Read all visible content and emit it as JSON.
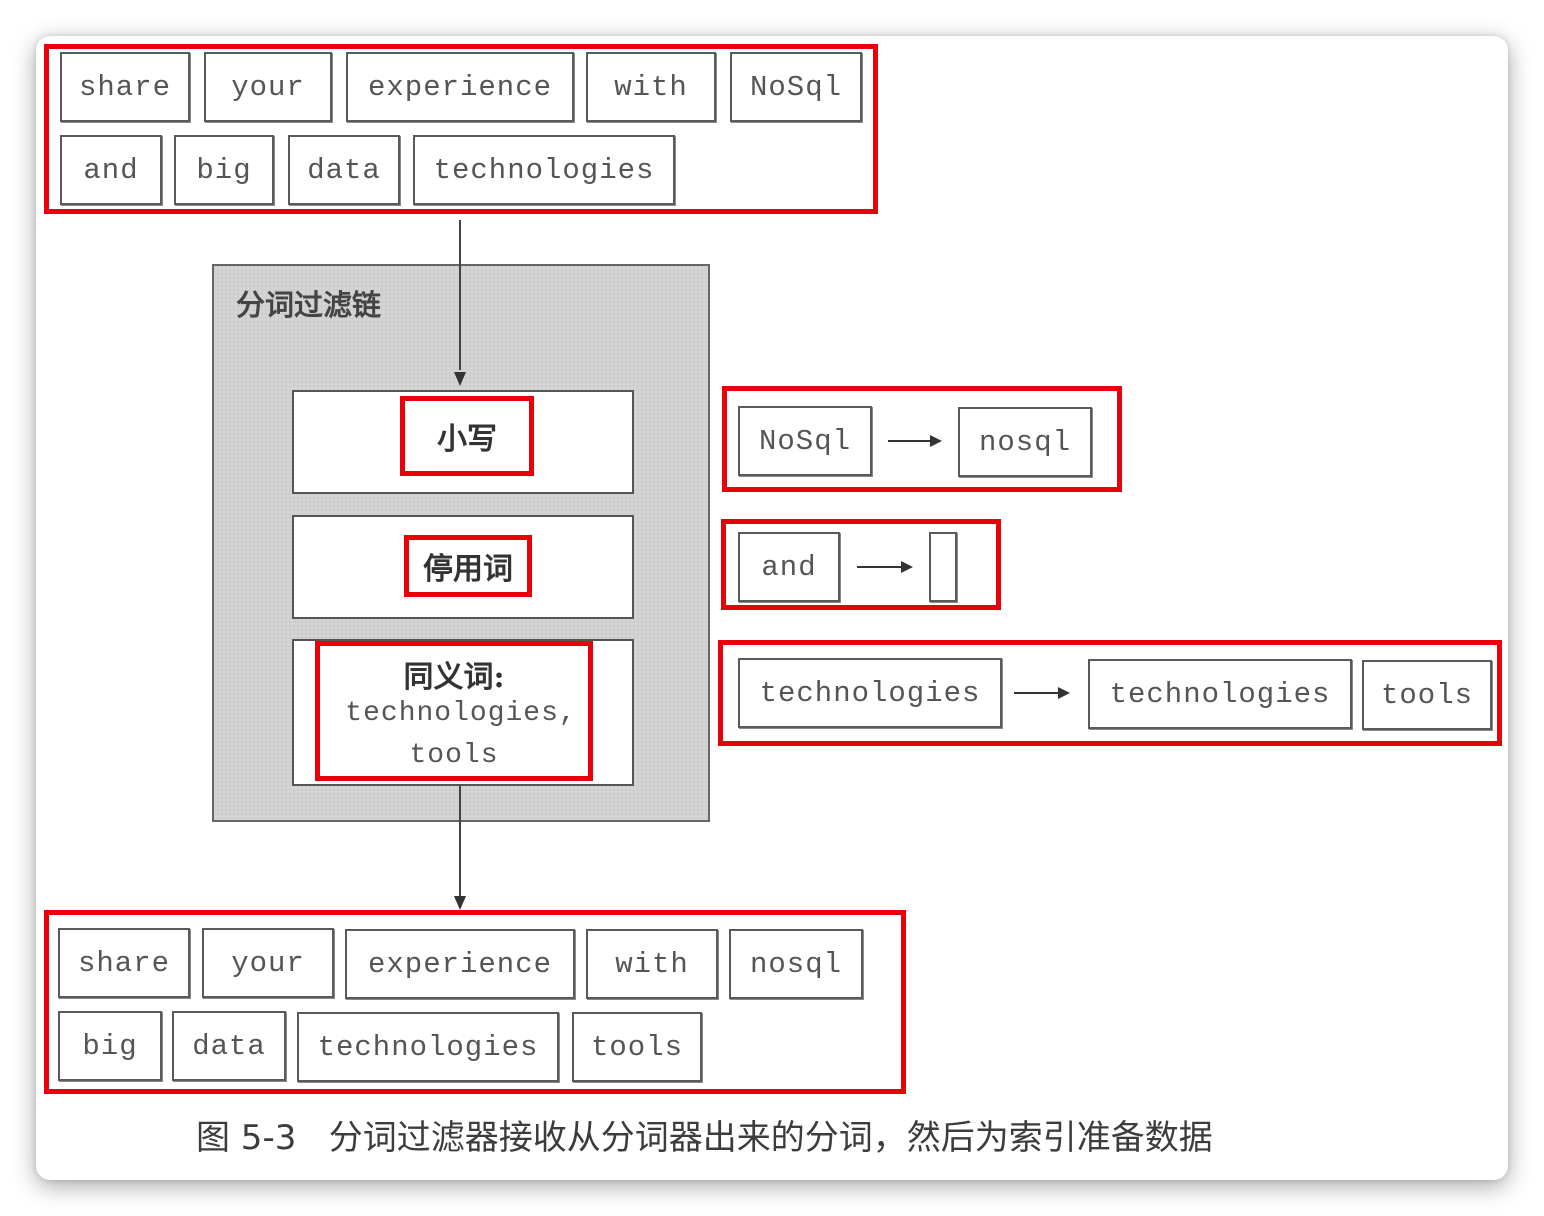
{
  "input_tokens": {
    "row1": [
      "share",
      "your",
      "experience",
      "with",
      "NoSql"
    ],
    "row2": [
      "and",
      "big",
      "data",
      "technologies"
    ]
  },
  "filter_chain": {
    "title": "分词过滤链",
    "filters": [
      {
        "label": "小写"
      },
      {
        "label": "停用词"
      },
      {
        "label": "同义词:",
        "lines": [
          "technologies,",
          "tools"
        ]
      }
    ]
  },
  "examples": {
    "lowercase": {
      "from": "NoSql",
      "to": "nosql"
    },
    "stopword": {
      "from": "and",
      "to": ""
    },
    "synonym": {
      "from": "technologies",
      "to": [
        "technologies",
        "tools"
      ]
    }
  },
  "output_tokens": {
    "row1": [
      "share",
      "your",
      "experience",
      "with",
      "nosql"
    ],
    "row2": [
      "big",
      "data",
      "technologies",
      "tools"
    ]
  },
  "caption": "图 5-3   分词过滤器接收从分词器出来的分词，然后为索引准备数据",
  "colors": {
    "highlight": "#e8000b",
    "chain_background": "#cfcfcf",
    "token_border": "#5a5a5a"
  }
}
